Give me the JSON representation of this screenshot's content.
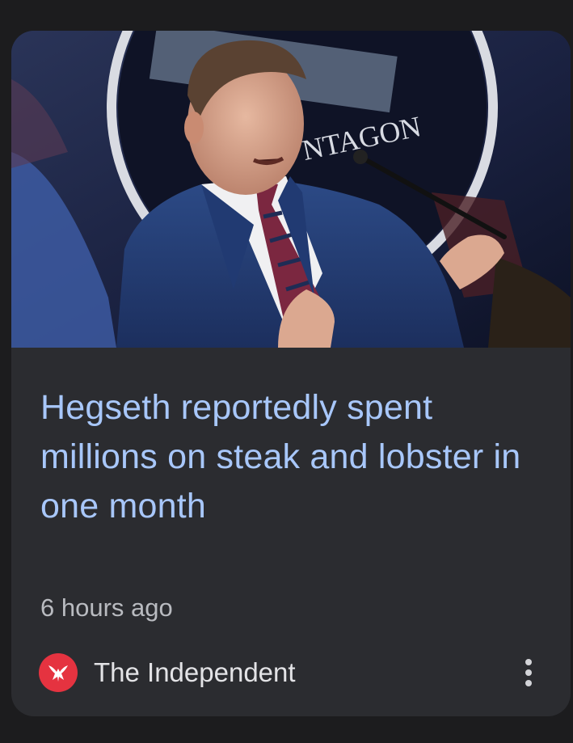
{
  "article": {
    "headline": "Hegseth reportedly spent millions on steak and lobster in one month",
    "time": "6 hours ago",
    "image_seal_text": "NTAGON",
    "image_icon": "press-briefing-photo"
  },
  "source": {
    "name": "The Independent",
    "logo_icon": "eagle-icon",
    "logo_color": "#e53340"
  },
  "menu": {
    "icon": "more-vert-icon"
  },
  "colors": {
    "background": "#1c1c1e",
    "card": "#2b2c30",
    "headline": "#a8c7fa",
    "secondary_text": "#b9bbc0"
  }
}
